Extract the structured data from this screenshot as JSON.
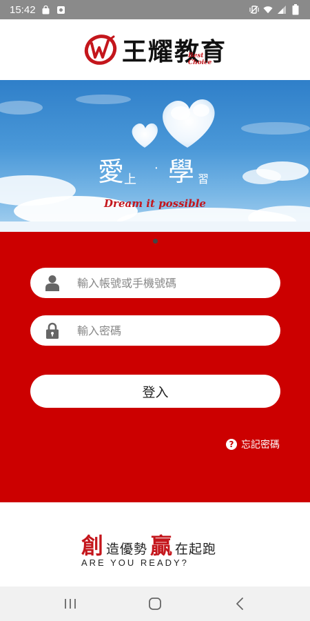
{
  "status_bar": {
    "time": "15:42",
    "left_icons": [
      "shopping-bag-icon",
      "camera-notification-icon"
    ],
    "right_icons": [
      "mute-vibrate-icon",
      "wifi-icon",
      "signal-icon",
      "battery-icon"
    ]
  },
  "header": {
    "logo_icon": "wangyao-w-logo-icon",
    "logo_text": "王耀教育",
    "logo_subtext": "Best Choice"
  },
  "banner": {
    "title_char_1": "愛",
    "title_char_2": "上",
    "title_dot": "‧",
    "title_char_3": "學",
    "title_char_4": "習",
    "tagline": "Dream it possible",
    "decorations": [
      "cloud-heart-large",
      "cloud-heart-small"
    ]
  },
  "login": {
    "account_placeholder": "輸入帳號或手機號碼",
    "account_value": "",
    "password_placeholder": "輸入密碼",
    "password_value": "",
    "login_label": "登入",
    "forgot_label": "忘記密碼"
  },
  "slogan": {
    "char_1": "創",
    "text_1": "造優勢",
    "char_2": "贏",
    "text_2": "在起跑",
    "english": "ARE YOU READY?"
  },
  "nav_bar": {
    "buttons": [
      "recent-apps-icon",
      "home-icon",
      "back-icon"
    ]
  },
  "colors": {
    "brand_red": "#cc0000",
    "logo_red": "#c4161c",
    "status_bar": "#8a8a8a",
    "sky_top": "#2f7fc9"
  }
}
